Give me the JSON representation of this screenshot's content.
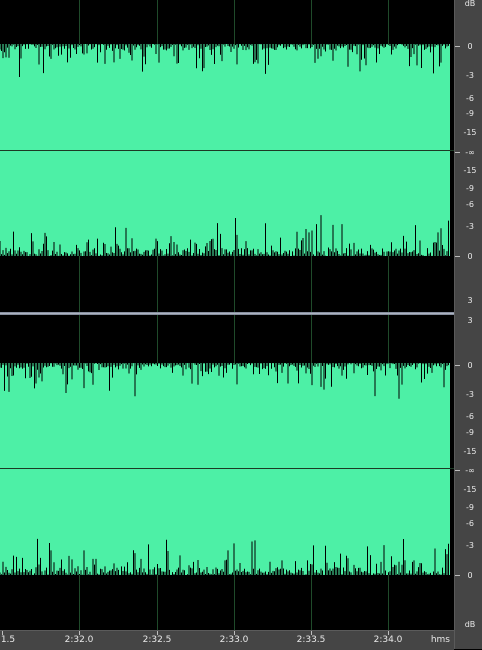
{
  "waveform": {
    "color": "#4df0a6",
    "background": "#000000",
    "grid_color": "#1f4a2a"
  },
  "db_ruler": {
    "unit_top": "dB",
    "channel1": [
      "0",
      "-3",
      "-6",
      "-9",
      "-15",
      "-∞",
      "-15",
      "-9",
      "-6",
      "-3",
      "0",
      "3"
    ],
    "channel2": [
      "3",
      "0",
      "-3",
      "-6",
      "-9",
      "-15",
      "-∞",
      "-15",
      "-9",
      "-6",
      "-3",
      "0"
    ],
    "unit_bottom": "dB"
  },
  "time_ruler": {
    "labels": [
      "1.5",
      "2:32.0",
      "2:32.5",
      "2:33.0",
      "2:33.5",
      "2:34.0"
    ],
    "unit": "hms"
  }
}
